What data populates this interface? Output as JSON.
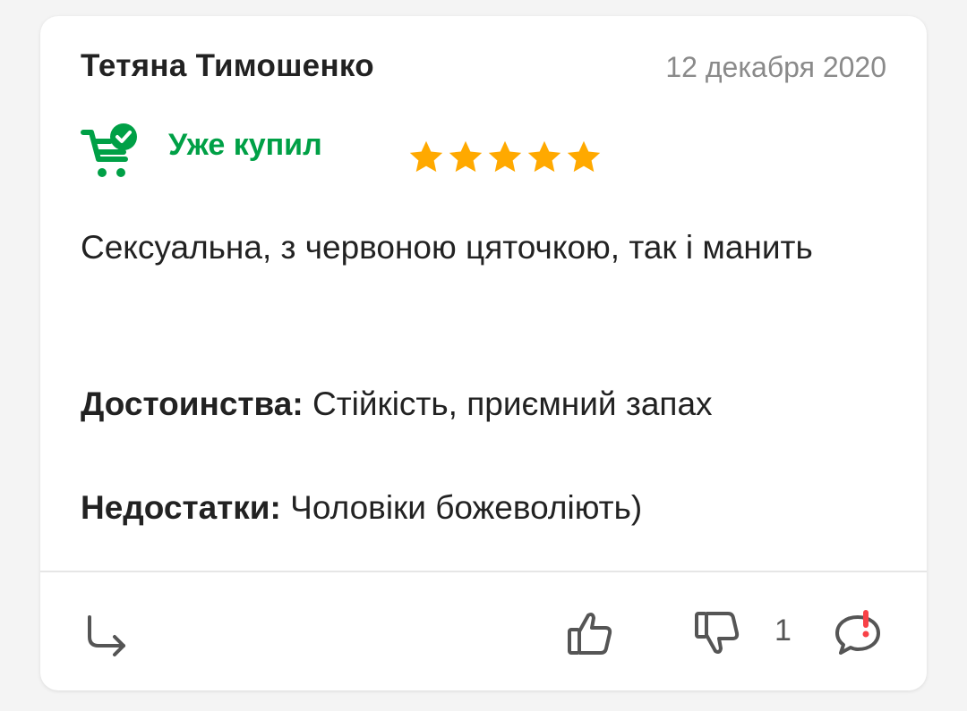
{
  "review": {
    "author": "Тетяна Тимошенко",
    "date": "12 декабря 2020",
    "purchased_label": "Уже купил",
    "rating": 5,
    "rating_max": 5,
    "comment": "Сексуальна, з червоною цяточкою, так і манить",
    "advantages_label": "Достоинства:",
    "advantages": "Стійкість, приємний запах",
    "disadvantages_label": "Недостатки:",
    "disadvantages": "Чоловіки божеволіють)"
  },
  "footer": {
    "dislike_count": "1"
  },
  "colors": {
    "accent_green": "#00a046",
    "star": "#ffa900",
    "alert_red": "#f84147",
    "icon_gray": "#555555"
  },
  "icons": [
    "cart-check-icon",
    "star-icon",
    "reply-arrow-icon",
    "thumbs-up-icon",
    "thumbs-down-icon",
    "complain-icon"
  ]
}
